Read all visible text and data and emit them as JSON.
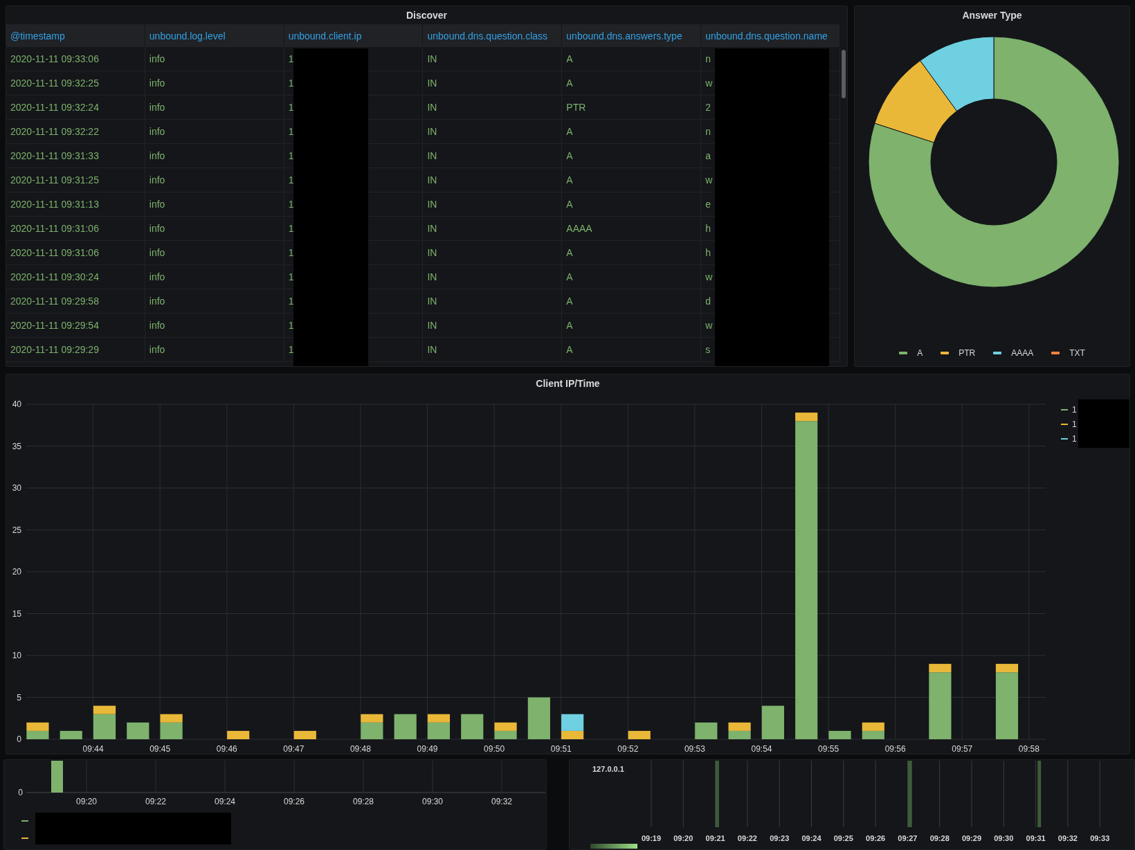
{
  "discover": {
    "title": "Discover",
    "columns": [
      "@timestamp",
      "unbound.log.level",
      "unbound.client.ip",
      "unbound.dns.question.class",
      "unbound.dns.answers.type",
      "unbound.dns.question.name"
    ],
    "rows": [
      [
        "2020-11-11 09:33:06",
        "info",
        "1",
        "IN",
        "A",
        "n"
      ],
      [
        "2020-11-11 09:32:25",
        "info",
        "1",
        "IN",
        "A",
        "w"
      ],
      [
        "2020-11-11 09:32:24",
        "info",
        "1",
        "IN",
        "PTR",
        "2"
      ],
      [
        "2020-11-11 09:32:22",
        "info",
        "1",
        "IN",
        "A",
        "n"
      ],
      [
        "2020-11-11 09:31:33",
        "info",
        "1",
        "IN",
        "A",
        "a"
      ],
      [
        "2020-11-11 09:31:25",
        "info",
        "1",
        "IN",
        "A",
        "w"
      ],
      [
        "2020-11-11 09:31:13",
        "info",
        "1",
        "IN",
        "A",
        "e"
      ],
      [
        "2020-11-11 09:31:06",
        "info",
        "1",
        "IN",
        "AAAA",
        "h"
      ],
      [
        "2020-11-11 09:31:06",
        "info",
        "1",
        "IN",
        "A",
        "h"
      ],
      [
        "2020-11-11 09:30:24",
        "info",
        "1",
        "IN",
        "A",
        "w"
      ],
      [
        "2020-11-11 09:29:58",
        "info",
        "1",
        "IN",
        "A",
        "d"
      ],
      [
        "2020-11-11 09:29:54",
        "info",
        "1",
        "IN",
        "A",
        "w"
      ],
      [
        "2020-11-11 09:29:29",
        "info",
        "1",
        "IN",
        "A",
        "s"
      ]
    ]
  },
  "answer_type": {
    "title": "Answer Type",
    "legend": [
      {
        "label": "A",
        "color": "#7eb26d"
      },
      {
        "label": "PTR",
        "color": "#eab839"
      },
      {
        "label": "AAAA",
        "color": "#6ed0e0"
      },
      {
        "label": "TXT",
        "color": "#ef843c"
      }
    ]
  },
  "client_ip_time": {
    "title": "Client IP/Time",
    "chart_data": {
      "type": "bar",
      "stacked": true,
      "x": [
        583.17,
        583.67,
        584.17,
        584.67,
        585.17,
        586.17,
        587.17,
        588.17,
        588.67,
        589.17,
        589.67,
        590.17,
        590.67,
        591.17,
        592.17,
        593.17,
        593.67,
        594.17,
        594.67,
        595.17,
        595.67,
        596.67,
        597.67
      ],
      "series": [
        {
          "name": "1",
          "color": "#7eb26d",
          "values": [
            1,
            1,
            3,
            2,
            2,
            0,
            0,
            2,
            3,
            2,
            3,
            1,
            5,
            0,
            0,
            2,
            1,
            4,
            38,
            1,
            1,
            8,
            8
          ]
        },
        {
          "name": "1",
          "color": "#eab839",
          "values": [
            1,
            0,
            1,
            0,
            1,
            1,
            1,
            1,
            0,
            1,
            0,
            1,
            0,
            1,
            1,
            0,
            1,
            0,
            1,
            0,
            1,
            1,
            1
          ]
        },
        {
          "name": "1",
          "color": "#6ed0e0",
          "values": [
            0,
            0,
            0,
            0,
            0,
            0,
            0,
            0,
            0,
            0,
            0,
            0,
            0,
            2,
            0,
            0,
            0,
            0,
            0,
            0,
            0,
            0,
            0
          ]
        }
      ],
      "grid": true,
      "xlim": [
        583,
        598.25
      ],
      "ylim": [
        0,
        40
      ],
      "xticks": [
        {
          "value": 584,
          "label": "09:44"
        },
        {
          "value": 585,
          "label": "09:45"
        },
        {
          "value": 586,
          "label": "09:46"
        },
        {
          "value": 587,
          "label": "09:47"
        },
        {
          "value": 588,
          "label": "09:48"
        },
        {
          "value": 589,
          "label": "09:49"
        },
        {
          "value": 590,
          "label": "09:50"
        },
        {
          "value": 591,
          "label": "09:51"
        },
        {
          "value": 592,
          "label": "09:52"
        },
        {
          "value": 593,
          "label": "09:53"
        },
        {
          "value": 594,
          "label": "09:54"
        },
        {
          "value": 595,
          "label": "09:55"
        },
        {
          "value": 596,
          "label": "09:56"
        },
        {
          "value": 597,
          "label": "09:57"
        },
        {
          "value": 598,
          "label": "09:58"
        }
      ],
      "yticks": [
        0,
        5,
        10,
        15,
        20,
        25,
        30,
        35,
        40
      ]
    }
  },
  "panel_4": {
    "y_ticks": [
      "0"
    ],
    "x_ticks": [
      "09:20",
      "09:22",
      "09:24",
      "09:26",
      "09:28",
      "09:30",
      "09:32"
    ],
    "legend": [
      {
        "color": "#7eb26d"
      },
      {
        "color": "#eab839"
      }
    ]
  },
  "panel_5": {
    "row_label": "127.0.0.1",
    "x_ticks": [
      "09:19",
      "09:20",
      "09:21",
      "09:22",
      "09:23",
      "09:24",
      "09:25",
      "09:26",
      "09:27",
      "09:28",
      "09:29",
      "09:30",
      "09:31",
      "09:32",
      "09:33"
    ]
  }
}
